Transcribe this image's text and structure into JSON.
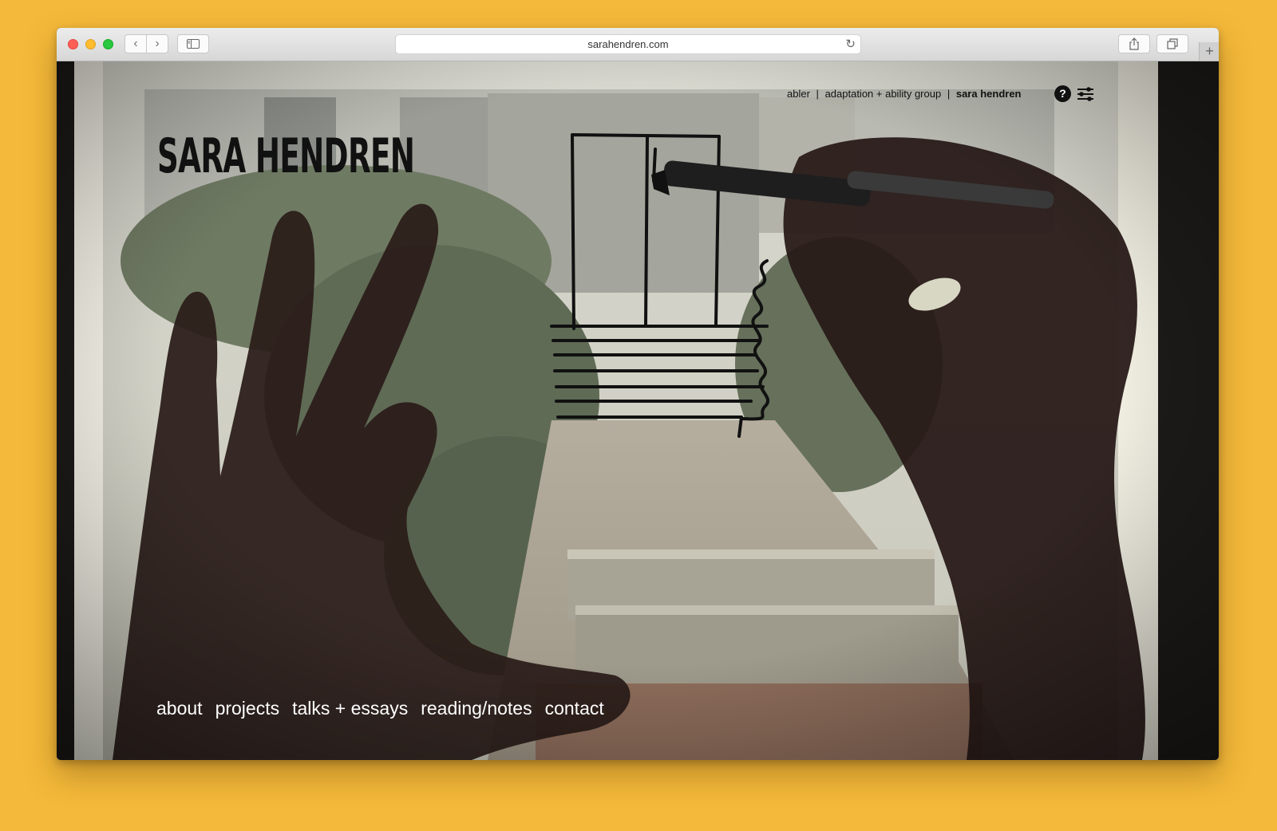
{
  "browser": {
    "url": "sarahendren.com",
    "back_icon": "‹",
    "forward_icon": "›",
    "reload_icon": "↻",
    "newtab_icon": "+"
  },
  "site": {
    "logo": "SARA HENDREN",
    "topnav": {
      "links": [
        "abler",
        "adaptation + ability group",
        "sara hendren"
      ],
      "separator": "|",
      "current": "sara hendren"
    },
    "help_icon_label": "?",
    "mainnav": [
      "about",
      "projects",
      "talks + essays",
      "reading/notes",
      "contact"
    ]
  },
  "colors": {
    "page_background": "#f4b93a",
    "logo_text": "#111111",
    "nav_text": "#ffffff"
  }
}
